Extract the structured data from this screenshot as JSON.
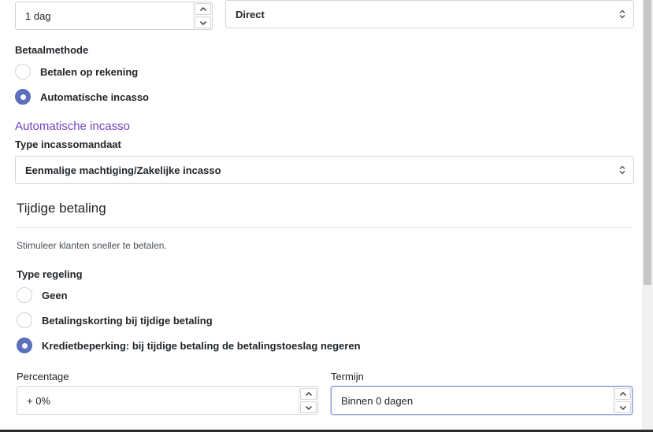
{
  "top": {
    "days_value": "1 dag",
    "direct_select": "Direct"
  },
  "betaalmethode": {
    "label": "Betaalmethode",
    "options": [
      {
        "label": "Betalen op rekening",
        "checked": false
      },
      {
        "label": "Automatische incasso",
        "checked": true
      }
    ]
  },
  "incasso": {
    "section_title": "Automatische incasso",
    "type_label": "Type incassomandaat",
    "type_value": "Eenmalige machtiging/Zakelijke incasso"
  },
  "tijdige": {
    "title": "Tijdige betaling",
    "description": "Stimuleer klanten sneller te betalen.",
    "type_label": "Type regeling",
    "options": [
      {
        "label": "Geen",
        "checked": false
      },
      {
        "label": "Betalingskorting bij tijdige betaling",
        "checked": false
      },
      {
        "label": "Kredietbeperking: bij tijdige betaling de betalingstoeslag negeren",
        "checked": true
      }
    ],
    "percentage_label": "Percentage",
    "percentage_value": "+ 0%",
    "termijn_label": "Termijn",
    "termijn_value": "Binnen 0 dagen"
  },
  "colors": {
    "accent": "#5b6fbd",
    "section_title": "#6f42c1",
    "focus_border": "#8a9ad8"
  },
  "icons": [
    "chevron-up-icon",
    "chevron-down-icon",
    "select-caret-icon"
  ]
}
